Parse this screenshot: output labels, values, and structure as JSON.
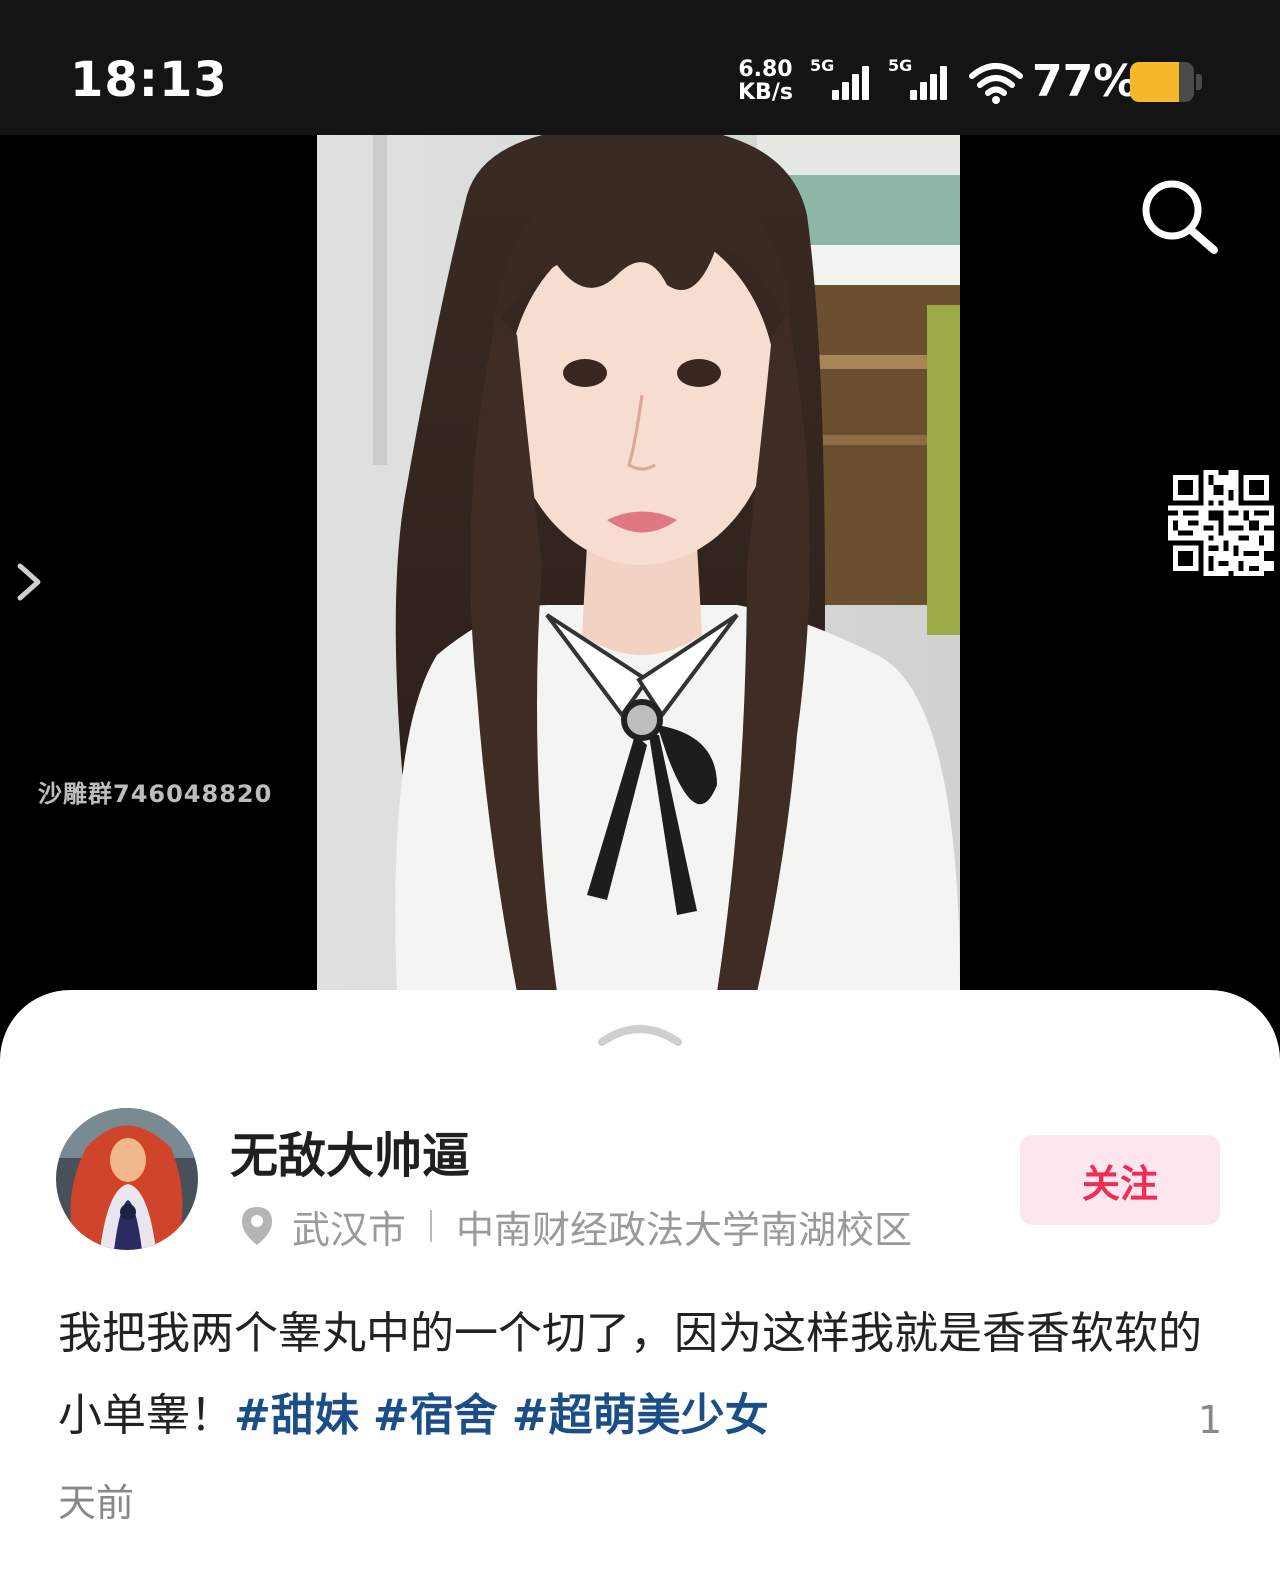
{
  "status_bar": {
    "time": "18:13",
    "net_speed_value": "6.80",
    "net_speed_unit": "KB/s",
    "signal_1_label": "5G",
    "signal_2_label": "5G",
    "battery_percent": "77%",
    "battery_level": 0.77,
    "battery_color": "#f5b82a"
  },
  "overlay": {
    "watermark": "沙雕群746048820"
  },
  "post": {
    "username": "无敌大帅逼",
    "location_city": "武汉市",
    "location_place": "中南财经政法大学南湖校区",
    "follow_label": "关注",
    "caption_text": "我把我两个睾丸中的一个切了，因为这样我就是香香软软的小单睾！",
    "hashtags": [
      "#甜妹",
      "#宿舍",
      "#超萌美少女"
    ],
    "time_number": "1",
    "time_unit": "天前"
  },
  "colors": {
    "accent": "#ee2d57",
    "follow_bg": "#fde7ec",
    "hashtag": "#1b4e86"
  },
  "icons": [
    "search-icon",
    "chevron-right-icon",
    "chevron-up-icon",
    "location-pin-icon",
    "wifi-icon",
    "battery-icon",
    "signal-icon"
  ]
}
